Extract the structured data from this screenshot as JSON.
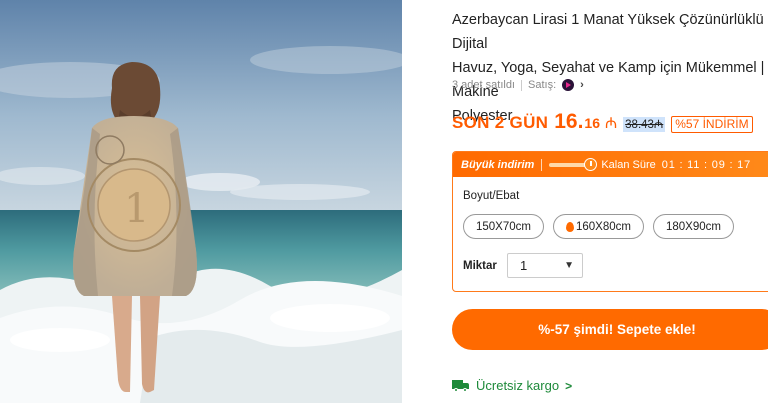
{
  "product": {
    "title": "Azerbaycan Lirasi 1 Manat Yüksek Çözünürlüklü Dijital\nHavuz, Yoga, Seyahat ve Kamp için Mükemmel | Makine\nPolyester",
    "image_alt": "product-photo-woman-with-towel-at-beach"
  },
  "meta": {
    "sold": "3 adet satıldı",
    "seller_label": "Satış:",
    "seller_icon": "seller-logo-icon",
    "chevron": "›"
  },
  "price": {
    "countdown_label": "SON 2 GÜN",
    "price_int": "16.",
    "price_dec": "16",
    "currency": "₼",
    "old_price": "38.43₼",
    "discount_badge": "%57 İNDİRİM",
    "accent_color": "#ff5b00"
  },
  "deal": {
    "title": "Büyük indirim",
    "remaining_label": "Kalan Süre",
    "timer": "01 : 11 : 09 : 17",
    "progress": 0.85
  },
  "options": {
    "size_label": "Boyut/Ebat",
    "sizes": [
      "150X70cm",
      "160X80cm",
      "180X90cm"
    ],
    "hot_size_index": 1,
    "qty_label": "Miktar",
    "qty_value": "1"
  },
  "cta": {
    "label": "%-57 şimdi! Sepete ekle!",
    "color": "#ff6a00"
  },
  "shipping": {
    "label": "Ücretsiz kargo",
    "icon": "truck-icon",
    "chevron": ">",
    "color": "#1e8a3a"
  }
}
